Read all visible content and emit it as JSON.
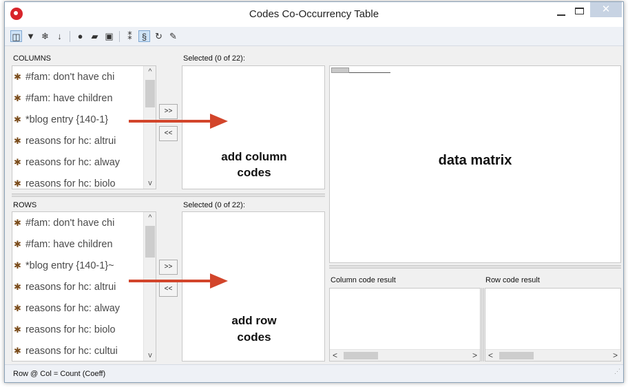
{
  "window": {
    "title": "Codes Co-Occurrency Table",
    "close_glyph": "✕"
  },
  "toolbar": {
    "icons": [
      "panel-layout-icon",
      "filter-icon",
      "snowflake-icon",
      "sort-az-icon",
      "color-wheel-icon",
      "chat-icon",
      "export-table-icon",
      "cluster-icon",
      "code-filter-icon",
      "refresh-icon",
      "wrench-icon"
    ]
  },
  "columns": {
    "header": "COLUMNS",
    "selected_label": "Selected (0 of 22):",
    "items": [
      "#fam: don't have chi",
      "#fam: have children",
      "*blog entry {140-1}",
      "reasons for hc: altrui",
      "reasons for hc: alway",
      "reasons for hc: biolo"
    ],
    "add_button": ">>",
    "remove_button": "<<",
    "annotation_line1": "add column",
    "annotation_line2": "codes"
  },
  "rows": {
    "header": "ROWS",
    "selected_label": "Selected (0 of 22):",
    "items": [
      "#fam: don't have chi",
      "#fam: have children",
      "*blog entry {140-1}~",
      "reasons for hc: altrui",
      "reasons for hc: alway",
      "reasons for hc: biolo",
      "reasons for hc: cultui"
    ],
    "add_button": ">>",
    "remove_button": "<<",
    "annotation_line1": "add row",
    "annotation_line2": "codes"
  },
  "matrix": {
    "annotation": "data matrix"
  },
  "results": {
    "column_label": "Column code result",
    "row_label": "Row code result"
  },
  "status": {
    "text": "Row @ Col = Count (Coeff)"
  },
  "colors": {
    "arrow": "#d2452b",
    "accent": "#d8252b"
  }
}
